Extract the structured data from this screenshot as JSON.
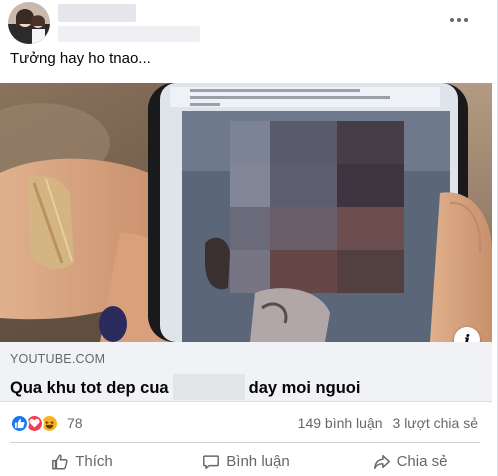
{
  "post": {
    "caption": "Tưởng hay ho tnao...",
    "more_icon": "more-horizontal-icon"
  },
  "media": {
    "alt": "",
    "info_glyph": "i"
  },
  "link": {
    "domain": "YOUTUBE.COM",
    "title_before": "Qua khu tot dep cua",
    "title_after": "day moi nguoi"
  },
  "stats": {
    "reaction_icons": [
      "like-icon",
      "love-icon",
      "haha-icon"
    ],
    "reaction_count": "78",
    "comments": "149 bình luận",
    "shares": "3 lượt chia sẻ"
  },
  "actions": {
    "like_label": "Thích",
    "comment_label": "Bình luận",
    "share_label": "Chia sẻ"
  },
  "colors": {
    "like_blue": "#1877f2",
    "love_red": "#f33e58",
    "haha_yellow": "#f7b125",
    "secondary_text": "#65676b",
    "link_bg": "#f0f2f5"
  }
}
